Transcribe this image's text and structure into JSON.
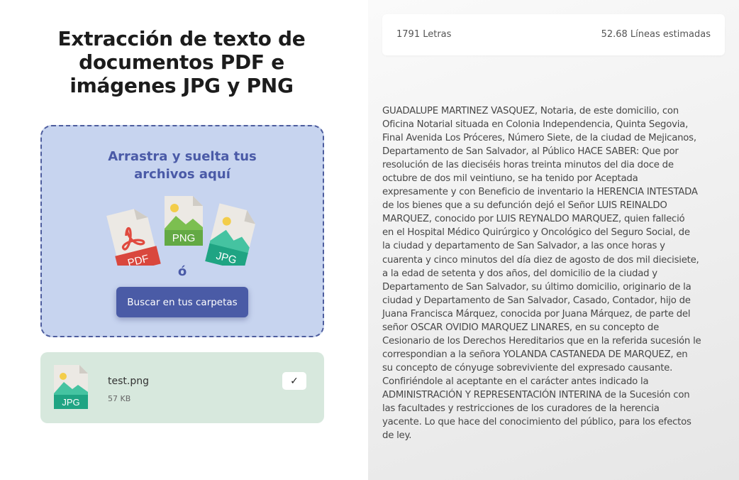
{
  "title": {
    "line1": "Extracción de texto de",
    "line2": "documentos PDF e",
    "line3": "imágenes JPG y PNG"
  },
  "dropzone": {
    "line1": "Arrastra y suelta tus",
    "line2": "archivos aquí",
    "or": "ó",
    "browse_label": "Buscar en tus carpetas",
    "icon_labels": {
      "pdf": "PDF",
      "png": "PNG",
      "jpg": "JPG"
    }
  },
  "file": {
    "name": "test.png",
    "size": "57 KB",
    "type_label": "JPG",
    "status_icon": "✓"
  },
  "stats": {
    "letters": "1791 Letras",
    "lines": "52.68 Líneas estimadas"
  },
  "extracted_text": [
    "GUADALUPE MARTINEZ VASQUEZ, Notaria, de este domicilio, con",
    "Oficina Notarial situada en Colonia Independencia, Quinta Segovia,",
    "Final Avenida Los Próceres, Número Siete, de la ciudad de Mejicanos,",
    "Departamento de San Salvador, al Público HACE SABER: Que por",
    "resolución de las dieciséis horas treinta minutos del dia doce de",
    "octubre de dos mil veintiuno, se ha tenido por Aceptada",
    "expresamente y con Beneficio de inventario la HERENCIA INTESTADA",
    "de los bienes que a su defunción dejó el Señor LUIS REINALDO",
    "MARQUEZ, conocido por LUIS REYNALDO MARQUEZ, quien falleció",
    "en el Hospital Médico Quirúrgico y Oncológico del Seguro Social, de",
    "la ciudad y departamento de San Salvador, a las once horas y",
    "cuarenta y cinco minutos del día diez de agosto de dos mil diecisiete,",
    "a la edad de setenta y dos años, del domicilio de la ciudad y",
    "Departamento de San Salvador, su último domicilio, originario de la",
    "ciudad y Departamento de San Salvador, Casado, Contador, hijo de",
    "Juana Francisca Márquez, conocida por Juana Márquez, de parte del",
    "señor OSCAR OVIDIO MARQUEZ LINARES, en su concepto de",
    "Cesionario de los Derechos Hereditarios que en la referida sucesión le",
    "correspondian a la señora YOLANDA CASTANEDA DE MARQUEZ, en",
    "su concepto de cónyuge sobreviviente del expresado causante.",
    "Confiriéndole al aceptante en el carácter antes indicado la",
    "ADMINISTRACIÓN Y REPRESENTACIÓN INTERINA de la Sucesión con",
    "las facultades y restricciones de los curadores de la herencia",
    "yacente. Lo que hace del conocimiento del público, para los efectos",
    "de ley."
  ],
  "colors": {
    "dropzone_bg": "#c7d4ef",
    "accent": "#4a5ba6",
    "file_card_bg": "#d7e8dd"
  }
}
